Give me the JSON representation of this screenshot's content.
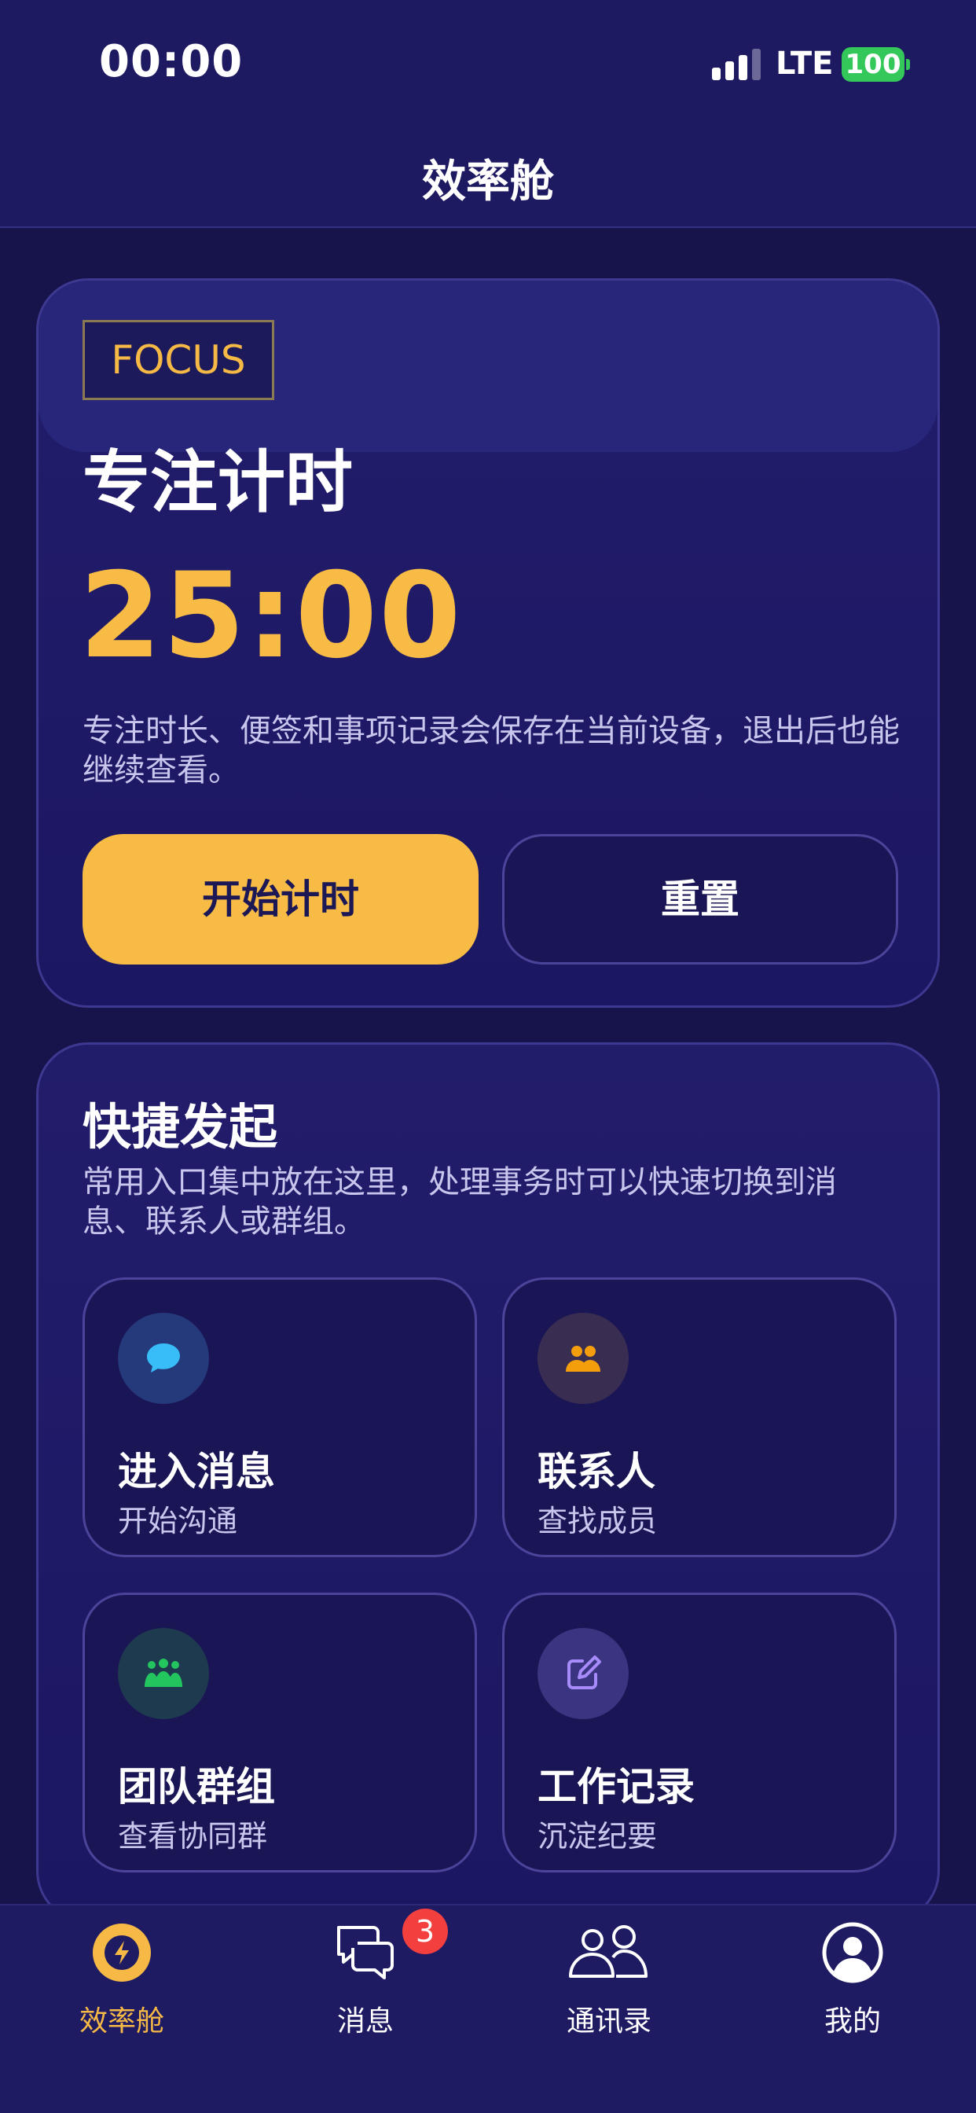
{
  "status_bar": {
    "time": "00:00",
    "network": "LTE",
    "battery": "100"
  },
  "nav": {
    "title": "效率舱"
  },
  "focus": {
    "badge": "FOCUS",
    "title": "专注计时",
    "timer": "25:00",
    "description": "专注时长、便签和事项记录会保存在当前设备，退出后也能继续查看。",
    "start_label": "开始计时",
    "reset_label": "重置"
  },
  "quick": {
    "title": "快捷发起",
    "description": "常用入口集中放在这里，处理事务时可以快速切换到消息、联系人或群组。",
    "items": [
      {
        "title": "进入消息",
        "subtitle": "开始沟通",
        "icon": "chat-bubble-icon",
        "color": "#38bdf8"
      },
      {
        "title": "联系人",
        "subtitle": "查找成员",
        "icon": "contacts-icon",
        "color": "#f59e0b"
      },
      {
        "title": "团队群组",
        "subtitle": "查看协同群",
        "icon": "team-group-icon",
        "color": "#22c55e"
      },
      {
        "title": "工作记录",
        "subtitle": "沉淀纪要",
        "icon": "edit-note-icon",
        "color": "#a78bfa"
      }
    ]
  },
  "tabs": [
    {
      "label": "效率舱",
      "icon": "lightning-icon",
      "active": true
    },
    {
      "label": "消息",
      "icon": "messages-icon",
      "badge": "3"
    },
    {
      "label": "通讯录",
      "icon": "contacts-tab-icon"
    },
    {
      "label": "我的",
      "icon": "profile-icon"
    }
  ],
  "colors": {
    "accent": "#f8bb45",
    "background": "#17134b",
    "badge": "#f43f3f"
  }
}
